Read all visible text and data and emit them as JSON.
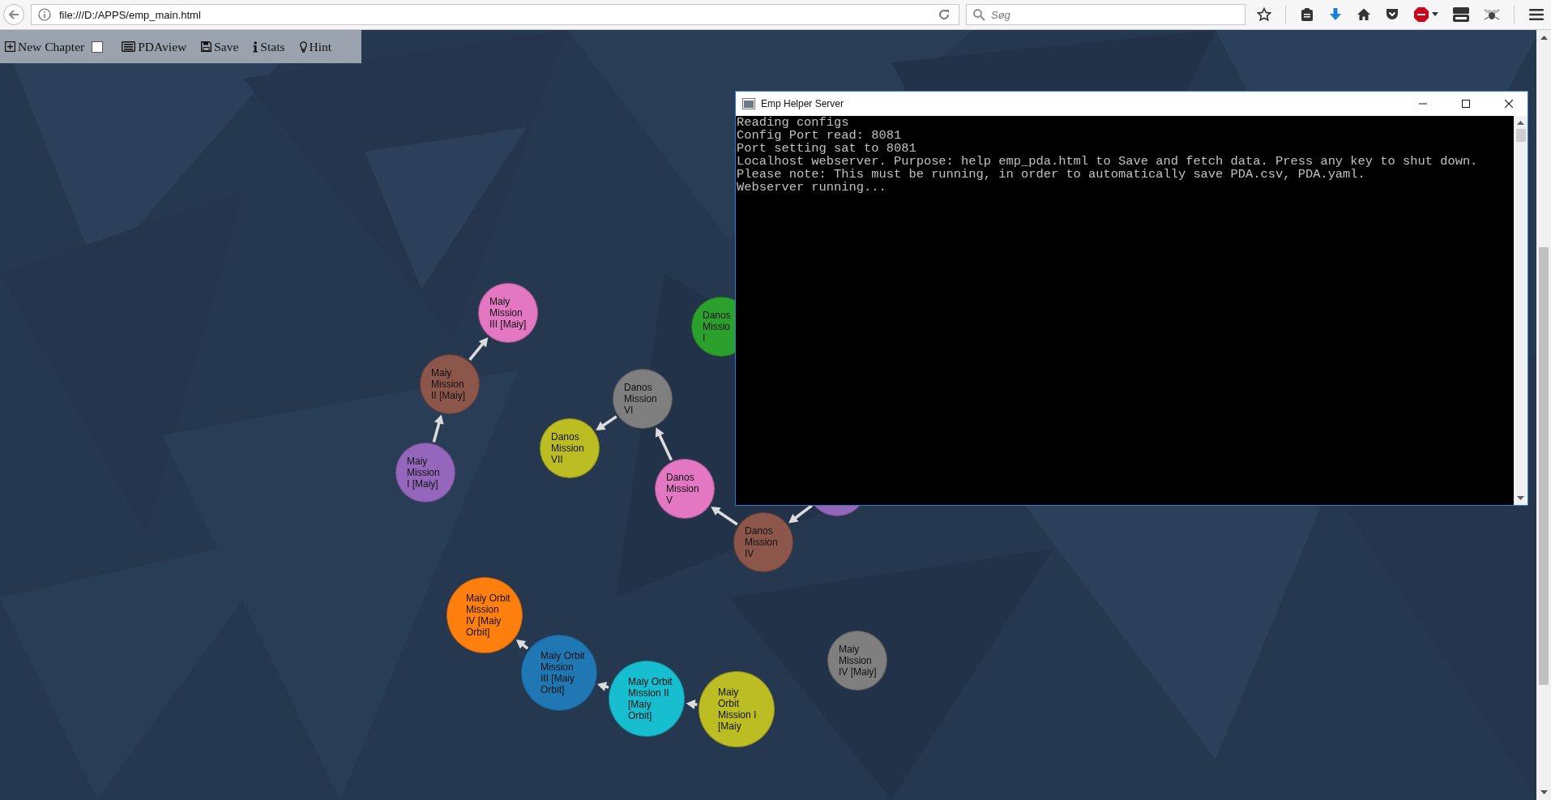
{
  "browser": {
    "url": "file:///D:/APPS/emp_main.html",
    "search": {
      "placeholder": "Søg"
    }
  },
  "toolbar": {
    "items": [
      {
        "kind": "new",
        "label": "New Chapter",
        "checked": false
      },
      {
        "kind": "pdaview",
        "label": "PDAview"
      },
      {
        "kind": "save",
        "label": "Save"
      },
      {
        "kind": "stats",
        "label": "Stats"
      },
      {
        "kind": "hint",
        "label": "Hint"
      }
    ]
  },
  "graph": {
    "nodes": [
      {
        "label_lines": [
          "Maiy",
          "Mission",
          "III [Maiy]"
        ],
        "color": "#e377c2"
      },
      {
        "label_lines": [
          "Maiy",
          "Mission",
          "II [Maiy]"
        ],
        "color": "#8c564b"
      },
      {
        "label_lines": [
          "Maiy",
          "Mission",
          "I [Maiy]"
        ],
        "color": "#9467bd"
      },
      {
        "label_lines": [
          "Danos",
          "Missio",
          "I"
        ],
        "color": "#2ca02c"
      },
      {
        "label_lines": [
          "Danos",
          "Mission",
          "VI"
        ],
        "color": "#7f7f7f"
      },
      {
        "label_lines": [
          "Danos",
          "Mission",
          "VII"
        ],
        "color": "#bcbd22"
      },
      {
        "label_lines": [
          "Danos",
          "Mission",
          "V"
        ],
        "color": "#e377c2"
      },
      {
        "label_lines": [
          "Danos",
          "Mission",
          "IV"
        ],
        "color": "#8c564b"
      },
      {
        "color": "#9467bd"
      },
      {
        "label_lines": [
          "Maiy Orbit",
          "Mission",
          "IV [Maiy",
          "Orbit]"
        ],
        "color": "#ff7f0e"
      },
      {
        "label_lines": [
          "Maiy Orbit",
          "Mission",
          "III [Maiy",
          "Orbit]"
        ],
        "color": "#1f77b4"
      },
      {
        "label_lines": [
          "Maiy Orbit",
          "Mission II",
          "[Maiy",
          "Orbit]"
        ],
        "color": "#17becf"
      },
      {
        "label_lines": [
          "Maiy",
          "Orbit",
          "Mission I",
          "[Maiy"
        ],
        "color": "#bcbd22"
      },
      {
        "label_lines": [
          "Maiy",
          "Mission",
          "IV [Maiy]"
        ],
        "color": "#7f7f7f"
      }
    ]
  },
  "console": {
    "title": "Emp Helper Server",
    "lines": [
      "Reading configs",
      "Config Port read: 8081",
      "Port setting sat to 8081",
      "Localhost webserver. Purpose: help emp_pda.html to Save and fetch data. Press any key to shut down.",
      "Please note: This must be running, in order to automatically save PDA.csv, PDA.yaml.",
      "Webserver running..."
    ]
  }
}
